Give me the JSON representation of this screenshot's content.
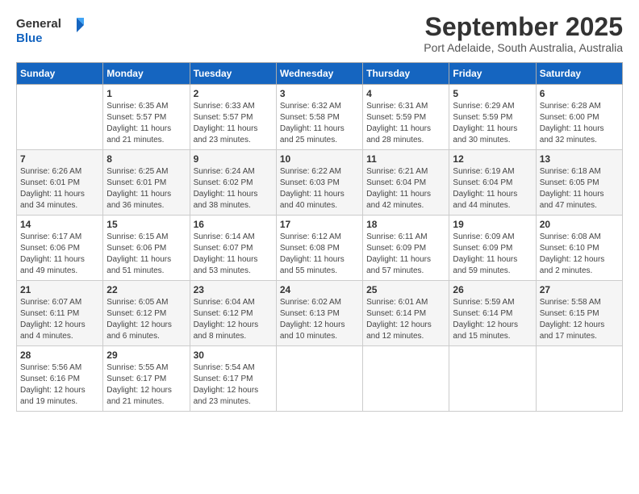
{
  "logo": {
    "line1": "General",
    "line2": "Blue"
  },
  "title": "September 2025",
  "subtitle": "Port Adelaide, South Australia, Australia",
  "weekdays": [
    "Sunday",
    "Monday",
    "Tuesday",
    "Wednesday",
    "Thursday",
    "Friday",
    "Saturday"
  ],
  "weeks": [
    [
      {
        "day": "",
        "info": ""
      },
      {
        "day": "1",
        "info": "Sunrise: 6:35 AM\nSunset: 5:57 PM\nDaylight: 11 hours\nand 21 minutes."
      },
      {
        "day": "2",
        "info": "Sunrise: 6:33 AM\nSunset: 5:57 PM\nDaylight: 11 hours\nand 23 minutes."
      },
      {
        "day": "3",
        "info": "Sunrise: 6:32 AM\nSunset: 5:58 PM\nDaylight: 11 hours\nand 25 minutes."
      },
      {
        "day": "4",
        "info": "Sunrise: 6:31 AM\nSunset: 5:59 PM\nDaylight: 11 hours\nand 28 minutes."
      },
      {
        "day": "5",
        "info": "Sunrise: 6:29 AM\nSunset: 5:59 PM\nDaylight: 11 hours\nand 30 minutes."
      },
      {
        "day": "6",
        "info": "Sunrise: 6:28 AM\nSunset: 6:00 PM\nDaylight: 11 hours\nand 32 minutes."
      }
    ],
    [
      {
        "day": "7",
        "info": "Sunrise: 6:26 AM\nSunset: 6:01 PM\nDaylight: 11 hours\nand 34 minutes."
      },
      {
        "day": "8",
        "info": "Sunrise: 6:25 AM\nSunset: 6:01 PM\nDaylight: 11 hours\nand 36 minutes."
      },
      {
        "day": "9",
        "info": "Sunrise: 6:24 AM\nSunset: 6:02 PM\nDaylight: 11 hours\nand 38 minutes."
      },
      {
        "day": "10",
        "info": "Sunrise: 6:22 AM\nSunset: 6:03 PM\nDaylight: 11 hours\nand 40 minutes."
      },
      {
        "day": "11",
        "info": "Sunrise: 6:21 AM\nSunset: 6:04 PM\nDaylight: 11 hours\nand 42 minutes."
      },
      {
        "day": "12",
        "info": "Sunrise: 6:19 AM\nSunset: 6:04 PM\nDaylight: 11 hours\nand 44 minutes."
      },
      {
        "day": "13",
        "info": "Sunrise: 6:18 AM\nSunset: 6:05 PM\nDaylight: 11 hours\nand 47 minutes."
      }
    ],
    [
      {
        "day": "14",
        "info": "Sunrise: 6:17 AM\nSunset: 6:06 PM\nDaylight: 11 hours\nand 49 minutes."
      },
      {
        "day": "15",
        "info": "Sunrise: 6:15 AM\nSunset: 6:06 PM\nDaylight: 11 hours\nand 51 minutes."
      },
      {
        "day": "16",
        "info": "Sunrise: 6:14 AM\nSunset: 6:07 PM\nDaylight: 11 hours\nand 53 minutes."
      },
      {
        "day": "17",
        "info": "Sunrise: 6:12 AM\nSunset: 6:08 PM\nDaylight: 11 hours\nand 55 minutes."
      },
      {
        "day": "18",
        "info": "Sunrise: 6:11 AM\nSunset: 6:09 PM\nDaylight: 11 hours\nand 57 minutes."
      },
      {
        "day": "19",
        "info": "Sunrise: 6:09 AM\nSunset: 6:09 PM\nDaylight: 11 hours\nand 59 minutes."
      },
      {
        "day": "20",
        "info": "Sunrise: 6:08 AM\nSunset: 6:10 PM\nDaylight: 12 hours\nand 2 minutes."
      }
    ],
    [
      {
        "day": "21",
        "info": "Sunrise: 6:07 AM\nSunset: 6:11 PM\nDaylight: 12 hours\nand 4 minutes."
      },
      {
        "day": "22",
        "info": "Sunrise: 6:05 AM\nSunset: 6:12 PM\nDaylight: 12 hours\nand 6 minutes."
      },
      {
        "day": "23",
        "info": "Sunrise: 6:04 AM\nSunset: 6:12 PM\nDaylight: 12 hours\nand 8 minutes."
      },
      {
        "day": "24",
        "info": "Sunrise: 6:02 AM\nSunset: 6:13 PM\nDaylight: 12 hours\nand 10 minutes."
      },
      {
        "day": "25",
        "info": "Sunrise: 6:01 AM\nSunset: 6:14 PM\nDaylight: 12 hours\nand 12 minutes."
      },
      {
        "day": "26",
        "info": "Sunrise: 5:59 AM\nSunset: 6:14 PM\nDaylight: 12 hours\nand 15 minutes."
      },
      {
        "day": "27",
        "info": "Sunrise: 5:58 AM\nSunset: 6:15 PM\nDaylight: 12 hours\nand 17 minutes."
      }
    ],
    [
      {
        "day": "28",
        "info": "Sunrise: 5:56 AM\nSunset: 6:16 PM\nDaylight: 12 hours\nand 19 minutes."
      },
      {
        "day": "29",
        "info": "Sunrise: 5:55 AM\nSunset: 6:17 PM\nDaylight: 12 hours\nand 21 minutes."
      },
      {
        "day": "30",
        "info": "Sunrise: 5:54 AM\nSunset: 6:17 PM\nDaylight: 12 hours\nand 23 minutes."
      },
      {
        "day": "",
        "info": ""
      },
      {
        "day": "",
        "info": ""
      },
      {
        "day": "",
        "info": ""
      },
      {
        "day": "",
        "info": ""
      }
    ]
  ]
}
